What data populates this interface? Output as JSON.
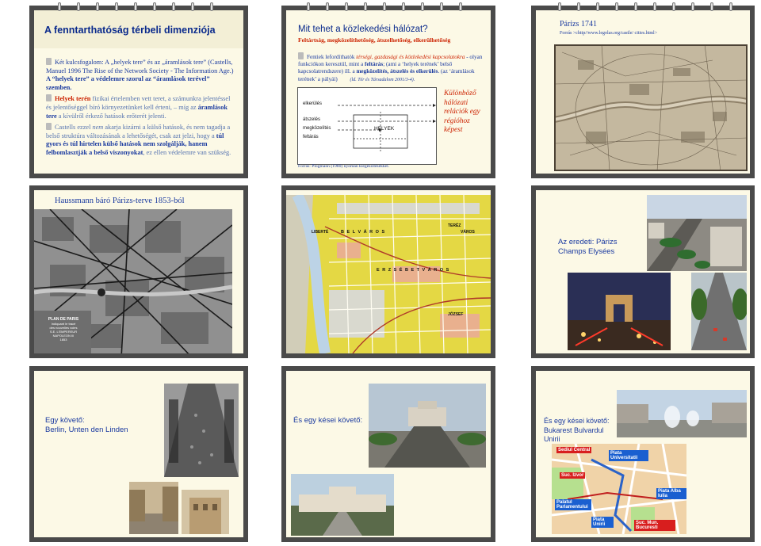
{
  "slide1": {
    "title": "A fenntarthatóság térbeli dimenziója",
    "b1_a": "Két kulcsfogalom: A „helyek tere” és az „áramlások tere” (Castells, Manuel 1996 The Rise of the Network Society - The Information Age.) ",
    "b1_b": "A “helyek tere” a védelemre szorul az “áramlások terével” szemben.",
    "b2_a": "Helyek terén",
    "b2_b": " fizikai értelemben vett teret, a számunkra jelentéssel és jelentőséggel bíró környezetünket kell érteni, – míg az ",
    "b2_c": "áramlások tere",
    "b2_d": " a kívülről érkező hatások erőterét jelenti.",
    "b3_a": "Castells ezzel ",
    "b3_b": "nem",
    "b3_c": " akarja kizárni a külső hatások, és nem tagadja a belső struktúra változásának a lehetőségét, csak azt jelzi, hogy a ",
    "b3_d": "túl gyors és túl hirtelen külső hatások nem szolgálják, hanem felbomlasztják a belső viszonyokat",
    "b3_e": ", ez ellen védelemre van szükség."
  },
  "slide2": {
    "title": "Mit tehet a közlekedési hálózat?",
    "subtitle": "Feltártság, megközelíthetőség, átszelhetőség, elkerülhetőség",
    "body_a": "Fentiek lefordíthatók ",
    "body_b": "térségi, gazdasági és közlekedési kapcsolatokra",
    "body_c": " - olyan funkciókon keresztül, mint a ",
    "body_d": "feltárás",
    "body_e": "; (ami a ‘helyek terének’ belső kapcsolatrendszere) ill. a ",
    "body_f": "megközelítés, átszelés és elkerülés",
    "body_g": ". (az ‘áramlások terének’ a pályái)",
    "ref": "(ld. Tér és Társadalom 2001/3-4).",
    "diagram_labels": [
      "elkerülés",
      "átszelés",
      "megközelítés",
      "feltárás"
    ],
    "diagram_center": "HELYEK",
    "side_text": "Különböző hálózati relációk egy régióhoz képest",
    "source": "Forrás: Plogmann (1980) nyomán kiegészítésekkel."
  },
  "slide3": {
    "title": "Párizs 1741",
    "source": "Forrás >chttp//www.legolas.org/castle/ cities.html>"
  },
  "slide4": {
    "title": "Haussmann báró Párizs-terve 1853-ból",
    "map_label": [
      "PLAN DE PARIS",
      "Indiquant le tracé",
      "des nouvelles voies",
      "S.E. L'EMPEREUR",
      "NAPOLEON III",
      "1853"
    ]
  },
  "slide5": {
    "map_words": [
      "LIBERTÉ",
      "B E L V Á R O S",
      "E R Z S É B E T V Á R O S",
      "JÓZSEF",
      "TERÉZ",
      "VÁROS"
    ]
  },
  "slide6": {
    "label_line1": "Az eredeti: Párizs",
    "label_line2": "Champs Elysées"
  },
  "slide7": {
    "label_line1": "Egy követő:",
    "label_line2": "Berlin, Unten den Linden"
  },
  "slide8": {
    "label": "És egy kései követő:"
  },
  "slide9": {
    "label_line1": "És egy kései követő:",
    "label_line2": "Bukarest Bulvardul",
    "label_line3": "Unirii",
    "map_tags": [
      "Sediul Central",
      "Piata Universitatii",
      "Suc. Izvor",
      "Piata Alba Iulia",
      "Palatul Parlamentului",
      "Piata Unirii",
      "Suc. Mun. Bucuresti"
    ]
  },
  "colors": {
    "page_bg": "#ffffff",
    "slide_frame": "#4a4a4a",
    "slide_bg": "#fcf9e6",
    "title_blue": "#0a2a8c",
    "body_blue": "#1a3aa0",
    "accent_red": "#cc2200",
    "map_yellow": "#e8dc3a",
    "map_red_tag": "#d81e1e",
    "map_blue_tag": "#1a5fd0"
  }
}
